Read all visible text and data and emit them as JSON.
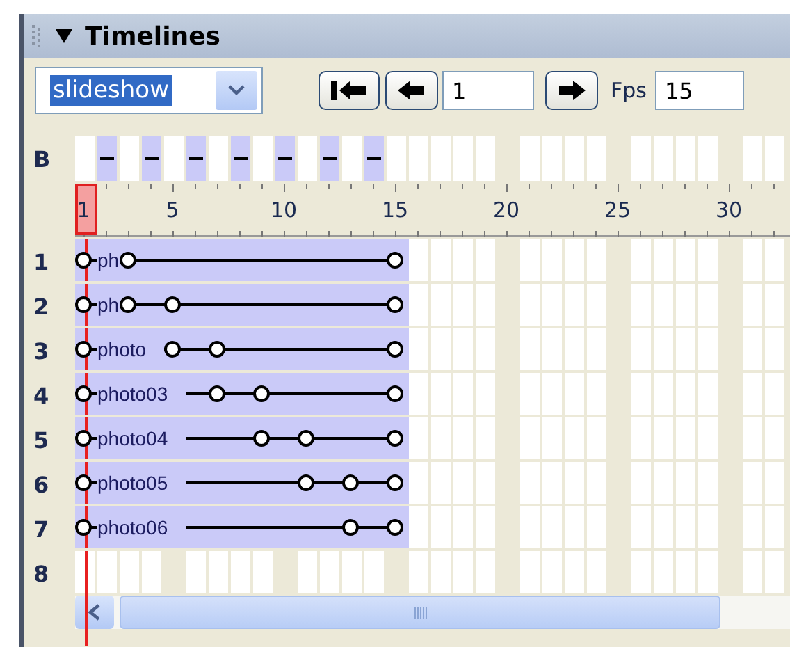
{
  "panel": {
    "title": "Timelines",
    "expanded": true
  },
  "toolbar": {
    "timeline": "slideshow",
    "frame": "1",
    "fps_label": "Fps",
    "fps": "15"
  },
  "behaviors": {
    "label": "B",
    "frames": [
      false,
      true,
      false,
      true,
      false,
      true,
      false,
      true,
      false,
      true,
      false,
      true,
      false,
      true,
      false
    ]
  },
  "ruler": {
    "labels": [
      "1",
      "5",
      "10",
      "15",
      "20",
      "25",
      "30"
    ]
  },
  "layers": [
    {
      "number": "1",
      "label": "ph",
      "keyframes": [
        true,
        false,
        true,
        false,
        false,
        false,
        false,
        false,
        false,
        false,
        false,
        false,
        false,
        false,
        true
      ]
    },
    {
      "number": "2",
      "label": "ph",
      "keyframes": [
        true,
        false,
        true,
        false,
        true,
        false,
        false,
        false,
        false,
        false,
        false,
        false,
        false,
        false,
        true
      ]
    },
    {
      "number": "3",
      "label": "photo",
      "keyframes": [
        true,
        false,
        false,
        false,
        true,
        false,
        true,
        false,
        false,
        false,
        false,
        false,
        false,
        false,
        true
      ]
    },
    {
      "number": "4",
      "label": "photo03",
      "keyframes": [
        true,
        false,
        false,
        false,
        false,
        false,
        true,
        false,
        true,
        false,
        false,
        false,
        false,
        false,
        true
      ]
    },
    {
      "number": "5",
      "label": "photo04",
      "keyframes": [
        true,
        false,
        false,
        false,
        false,
        false,
        false,
        false,
        true,
        false,
        true,
        false,
        false,
        false,
        true
      ]
    },
    {
      "number": "6",
      "label": "photo05",
      "keyframes": [
        true,
        false,
        false,
        false,
        false,
        false,
        false,
        false,
        false,
        false,
        true,
        false,
        true,
        false,
        true
      ]
    },
    {
      "number": "7",
      "label": "photo06",
      "keyframes": [
        true,
        false,
        false,
        false,
        false,
        false,
        false,
        false,
        false,
        false,
        false,
        false,
        true,
        false,
        true
      ]
    },
    {
      "number": "8"
    }
  ]
}
